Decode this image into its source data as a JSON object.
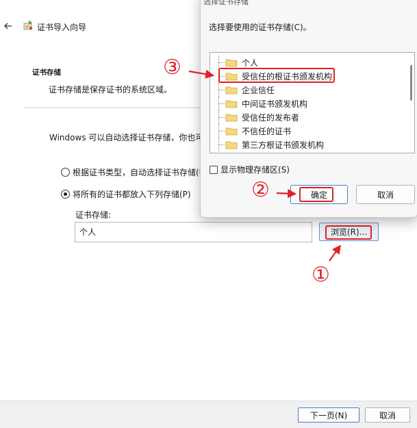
{
  "wizard": {
    "title": "证书导入向导",
    "section_heading": "证书存储",
    "section_desc": "证书存储是保存证书的系统区域。",
    "auto_text": "Windows 可以自动选择证书存储，你也可",
    "radio_auto_label": "根据证书类型，自动选择证书存储(U",
    "radio_manual_label": "将所有的证书都放入下列存储(P)",
    "store_label": "证书存储:",
    "store_value": "个人",
    "browse_label": "浏览(R)...",
    "next_label": "下一页(N)",
    "cancel_label": "取消",
    "selected_option": "radio_manual"
  },
  "dialog": {
    "title": "选择证书存储",
    "prompt": "选择要使用的证书存储(C)。",
    "tree_items": [
      {
        "label": "个人"
      },
      {
        "label": "受信任的根证书颁发机构"
      },
      {
        "label": "企业信任"
      },
      {
        "label": "中间证书颁发机构"
      },
      {
        "label": "受信任的发布者"
      },
      {
        "label": "不信任的证书"
      },
      {
        "label": "第三方根证书颁发机构"
      }
    ],
    "show_physical_label": "显示物理存储区(S)",
    "ok_label": "确定",
    "cancel_label": "取消"
  },
  "annotations": {
    "step1": "①",
    "step2": "②",
    "step3": "③",
    "color": "#e0202a"
  },
  "icons": {
    "back": "back-arrow-icon",
    "wizard": "certificate-wizard-icon",
    "folder": "folder-icon"
  }
}
